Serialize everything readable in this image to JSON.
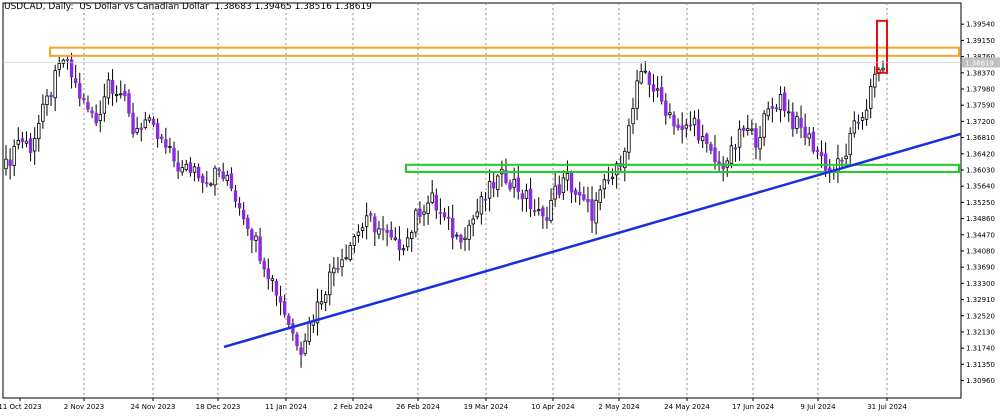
{
  "header": {
    "symbol_line": "USDCAD, Daily:  US Dollar vs Canadian Dollar  1.38683 1.39465 1.38516 1.38619"
  },
  "colors": {
    "background": "#ffffff",
    "bull_candle_body": "#ffffff",
    "bear_candle_body": "#8a2be2",
    "candle_outline": "#000000",
    "orange_zone": "#f5a623",
    "green_zone": "#22cc22",
    "trendline": "#1a2ee0",
    "highlight_box": "#e01010",
    "grid_vline": "#888888",
    "price_tag": "#c0c0c0"
  },
  "chart_data": {
    "type": "candlestick",
    "title": "USDCAD, Daily",
    "ylim": [
      1.3054,
      1.4005
    ],
    "y_ticks": [
      "1.39540",
      "1.39150",
      "1.38760",
      "1.38370",
      "1.37980",
      "1.37590",
      "1.37200",
      "1.36810",
      "1.36420",
      "1.36030",
      "1.35640",
      "1.35250",
      "1.34860",
      "1.34470",
      "1.34080",
      "1.33690",
      "1.33300",
      "1.32910",
      "1.32520",
      "1.32130",
      "1.31740",
      "1.31350",
      "1.30960"
    ],
    "x_ticks": [
      "11 Oct 2023",
      "2 Nov 2023",
      "24 Nov 2023",
      "18 Dec 2023",
      "11 Jan 2024",
      "2 Feb 2024",
      "26 Feb 2024",
      "19 Mar 2024",
      "10 Apr 2024",
      "2 May 2024",
      "24 May 2024",
      "17 Jun 2024",
      "9 Jul 2024",
      "31 Jul 2024"
    ],
    "last_price_label": "1.38619",
    "candle_count": 215,
    "anchors": [
      [
        0,
        1.362
      ],
      [
        10,
        1.37
      ],
      [
        18,
        1.382
      ],
      [
        26,
        1.387
      ],
      [
        34,
        1.376
      ],
      [
        42,
        1.381
      ],
      [
        50,
        1.378
      ],
      [
        58,
        1.37
      ],
      [
        66,
        1.363
      ],
      [
        74,
        1.358
      ],
      [
        82,
        1.361
      ],
      [
        90,
        1.352
      ],
      [
        97,
        1.342
      ],
      [
        103,
        1.334
      ],
      [
        109,
        1.327
      ],
      [
        115,
        1.319
      ],
      [
        121,
        1.325
      ],
      [
        127,
        1.336
      ],
      [
        133,
        1.346
      ],
      [
        139,
        1.351
      ],
      [
        145,
        1.347
      ],
      [
        151,
        1.344
      ],
      [
        157,
        1.351
      ],
      [
        163,
        1.356
      ],
      [
        169,
        1.349
      ],
      [
        175,
        1.346
      ],
      [
        181,
        1.355
      ],
      [
        187,
        1.359
      ],
      [
        193,
        1.356
      ],
      [
        199,
        1.355
      ],
      [
        205,
        1.358
      ],
      [
        211,
        1.36
      ],
      [
        215,
        1.358
      ]
    ],
    "segments": [
      {
        "from": 0,
        "to": 215,
        "anchors": "see above"
      }
    ],
    "orange_zone": {
      "y_top": 1.3895,
      "y_bottom": 1.3885,
      "from_date": "1 Nov 2023",
      "to_date": "6 Aug 2024"
    },
    "green_zone": {
      "y_top": 1.3613,
      "y_bottom": 1.3603,
      "from_date": "26 Feb 2024",
      "to_date": "6 Aug 2024"
    },
    "trendline": {
      "start_date": "18 Dec 2023",
      "start_price": 1.3177,
      "end_date": "8 Aug 2024",
      "end_price": 1.369
    },
    "highlight_box": {
      "date": "5 Aug 2024",
      "y_top": 1.3962,
      "y_bottom": 1.3837
    }
  }
}
